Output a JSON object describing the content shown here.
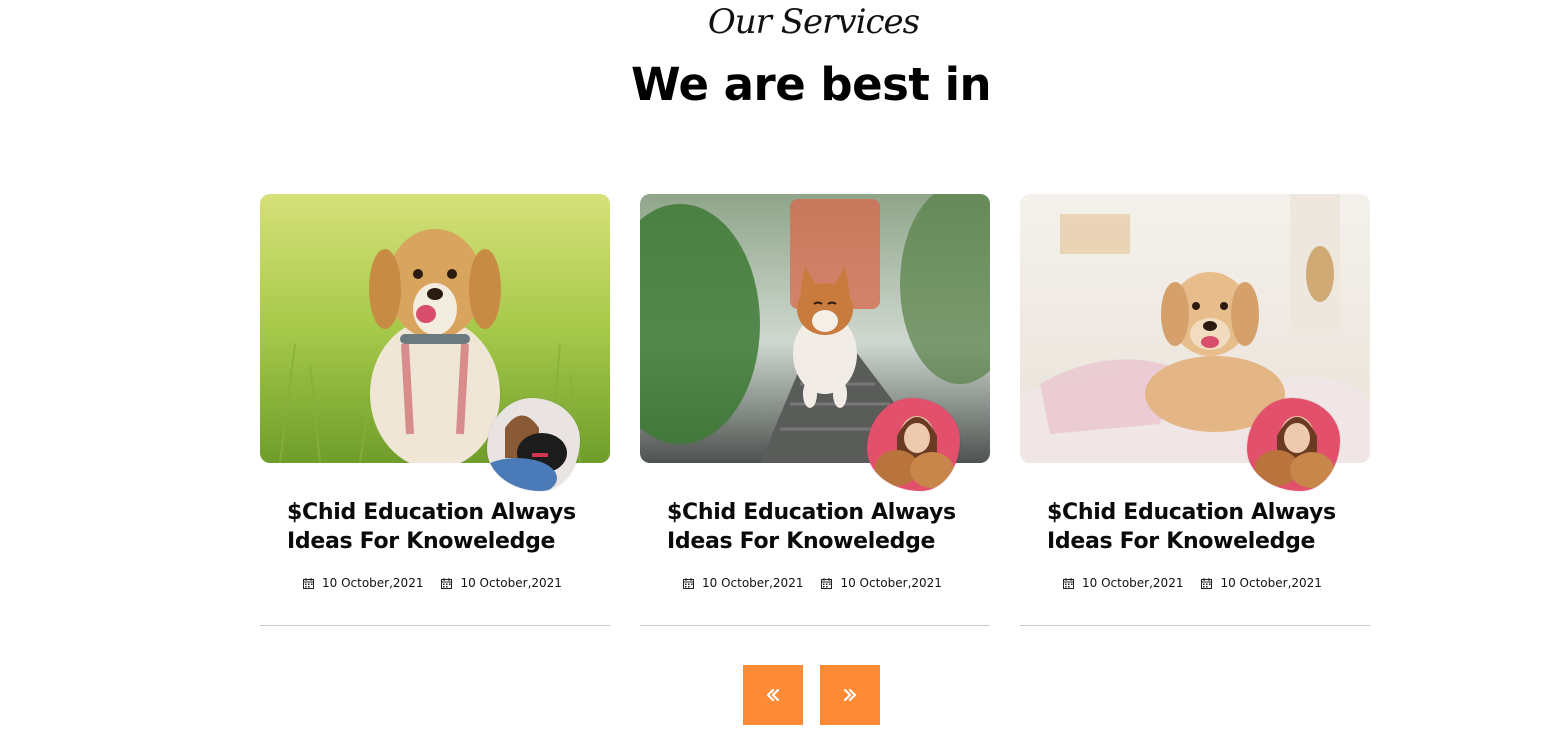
{
  "header": {
    "subtitle": "Our Services",
    "title": "We are best in"
  },
  "cards": [
    {
      "title": "$Chid Education Always Ideas For Knoweledge",
      "dates": [
        "10 October,2021",
        "10 October,2021"
      ],
      "image": "beagle-in-grass",
      "avatar": "woman-with-dog"
    },
    {
      "title": "$Chid Education Always Ideas For Knoweledge",
      "dates": [
        "10 October,2021",
        "10 October,2021"
      ],
      "image": "corgi-on-rails",
      "avatar": "woman-with-dogs-pink"
    },
    {
      "title": "$Chid Education Always Ideas For Knoweledge",
      "dates": [
        "10 October,2021",
        "10 October,2021"
      ],
      "image": "golden-retriever-on-rug",
      "avatar": "woman-with-dogs-pink"
    }
  ],
  "navigation": {
    "prev_icon": "double-chevron-left-icon",
    "next_icon": "double-chevron-right-icon"
  },
  "colors": {
    "accent": "#ff8a35",
    "divider": "#c9c9c9",
    "text": "#111111"
  }
}
